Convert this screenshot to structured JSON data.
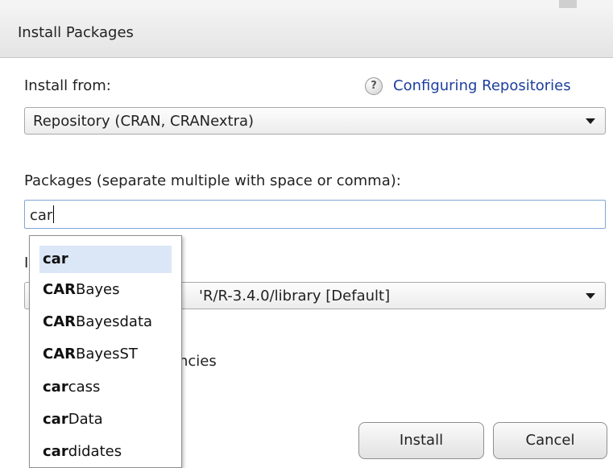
{
  "dialog": {
    "title": "Install Packages"
  },
  "install_from": {
    "label": "Install from:",
    "help_glyph": "?",
    "help_link": "Configuring Repositories",
    "selected": "Repository (CRAN, CRANextra)"
  },
  "packages": {
    "label": "Packages (separate multiple with space or comma):",
    "value": "car",
    "suggestions": [
      {
        "match": "car",
        "rest": ""
      },
      {
        "match": "CAR",
        "rest": "Bayes"
      },
      {
        "match": "CAR",
        "rest": "Bayesdata"
      },
      {
        "match": "CAR",
        "rest": "BayesST"
      },
      {
        "match": "car",
        "rest": "cass"
      },
      {
        "match": "car",
        "rest": "Data"
      },
      {
        "match": "car",
        "rest": "didates"
      }
    ]
  },
  "library": {
    "label_partial": "I",
    "selected_partial": "'R/R-3.4.0/library [Default]"
  },
  "dependencies": {
    "label_partial": "ncies"
  },
  "buttons": {
    "install": "Install",
    "cancel": "Cancel"
  }
}
